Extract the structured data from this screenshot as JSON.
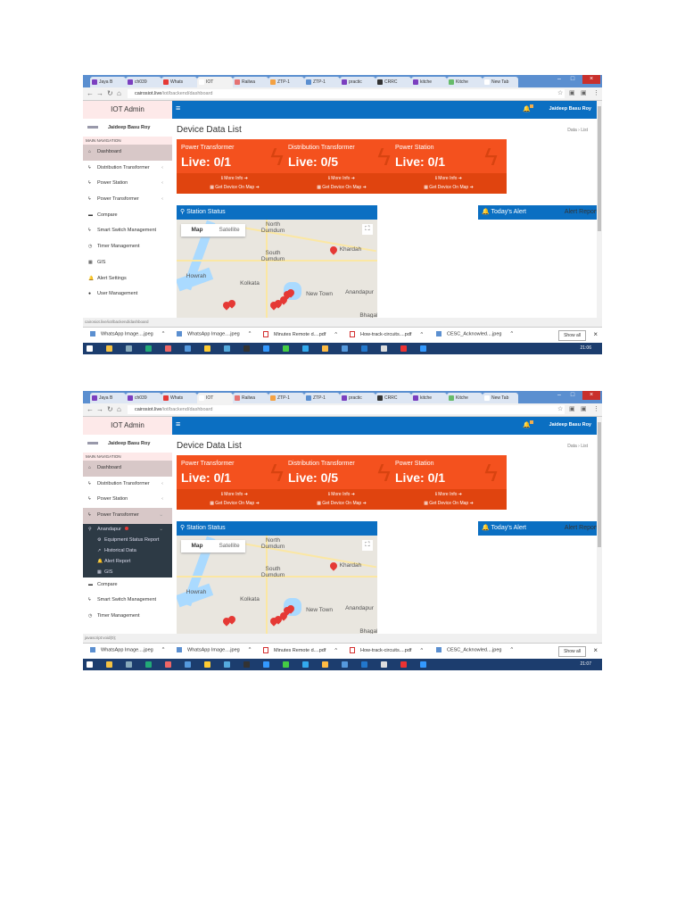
{
  "screenshots": [
    {
      "tabs": [
        "Jaya B",
        "ch039",
        "Whats",
        "IOT",
        "Railwa",
        "ZTP-1",
        "ZTP-1",
        "practic",
        "CRRC",
        "kitche",
        "Kitche",
        "New Tab"
      ],
      "active_tab": 3,
      "url_host": "cairosiot.live",
      "url_path": "/iot/backend/dashboard",
      "brand": "IOT Admin",
      "user": "Jaideep Basu Roy",
      "main_nav": "MAIN NAVIGATION",
      "menu": [
        {
          "label": "Dashboard",
          "icon": "⌂",
          "sel": true
        },
        {
          "label": "Distribution Transformer",
          "icon": "ϟ",
          "ch": "‹"
        },
        {
          "label": "Power Station",
          "icon": "ϟ",
          "ch": "‹"
        },
        {
          "label": "Power Transformer",
          "icon": "ϟ",
          "ch": "‹"
        },
        {
          "label": "Compare",
          "icon": "▬"
        },
        {
          "label": "Smart Switch Management",
          "icon": "ϟ"
        },
        {
          "label": "Timer Management",
          "icon": "◷"
        },
        {
          "label": "GIS",
          "icon": "▦"
        },
        {
          "label": "Alert Settings",
          "icon": "🔔"
        },
        {
          "label": "User Management",
          "icon": "●"
        }
      ],
      "status_url": "cairosiot.live/iot/backend/dashboard",
      "clock": "21:06"
    },
    {
      "tabs": [
        "Jaya B",
        "ch039",
        "Whats",
        "IOT",
        "Railwa",
        "ZTP-1",
        "ZTP-1",
        "practic",
        "CRRC",
        "kitche",
        "Kitche",
        "New Tab"
      ],
      "active_tab": 3,
      "url_host": "cairosiot.live",
      "url_path": "/iot/backend/dashboard",
      "brand": "IOT Admin",
      "user": "Jaideep Basu Roy",
      "main_nav": "MAIN NAVIGATION",
      "menu": [
        {
          "label": "Dashboard",
          "icon": "⌂",
          "sel": true
        },
        {
          "label": "Distribution Transformer",
          "icon": "ϟ",
          "ch": "‹"
        },
        {
          "label": "Power Station",
          "icon": "ϟ",
          "ch": "‹"
        },
        {
          "label": "Power Transformer",
          "icon": "ϟ",
          "ch": "⌄",
          "sel": true,
          "sub": [
            {
              "label": "Anandapur",
              "icon": "⚲",
              "ch": "⌄",
              "dot": true
            },
            {
              "label": "Equipment Status Report",
              "icon": "⚙",
              "indent": true
            },
            {
              "label": "Historical Data",
              "icon": "↗",
              "indent": true
            },
            {
              "label": "Alert Report",
              "icon": "🔔",
              "indent": true
            },
            {
              "label": "GIS",
              "icon": "▦",
              "indent": true
            }
          ]
        },
        {
          "label": "Compare",
          "icon": "▬"
        },
        {
          "label": "Smart Switch Management",
          "icon": "ϟ"
        },
        {
          "label": "Timer Management",
          "icon": "◷"
        }
      ],
      "status_url": "javascript:void(0);",
      "clock": "21:07"
    }
  ],
  "header_user": "Jaideep Basu Roy",
  "page_title": "Device Data List",
  "breadcrumb": [
    "Data",
    "List"
  ],
  "cards": [
    {
      "label": "Power Transformer",
      "value": "Live: 0/1"
    },
    {
      "label": "Distribution Transformer",
      "value": "Live: 0/5"
    },
    {
      "label": "Power Station",
      "value": "Live: 0/1"
    }
  ],
  "card_links": {
    "more": "ℹ More Info ➔",
    "map": "▦ Get Device On Map ➔"
  },
  "station_status": "⚲ Station Status",
  "todays_alert": "🔔 Today's Alert",
  "alert_report": "Alert Report",
  "map": {
    "btn_map": "Map",
    "btn_sat": "Satellite",
    "labels": [
      "North Dumdum",
      "South Dumdum",
      "Howrah",
      "Kolkata",
      "New Town",
      "Khardah",
      "Anandapur",
      "Bhagabati"
    ]
  },
  "downloads": [
    "WhatsApp Image....jpeg",
    "WhatsApp Image....jpeg",
    "Minutes Remote d....pdf",
    "How-track-circuits....pdf",
    "CESC_Acknowled....jpeg"
  ],
  "show_all": "Show all",
  "colors": {
    "brand_blue": "#0b6fc2",
    "card_orange": "#f4511e"
  }
}
